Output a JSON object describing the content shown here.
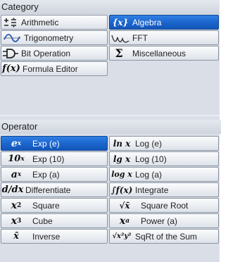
{
  "category": {
    "header": "Category",
    "buttons": [
      {
        "label": "Arithmetic",
        "icon": "plus-minus-icon"
      },
      {
        "label": "Algebra",
        "icon": "curly-x-icon",
        "icon_text": "{x}",
        "selected": true
      },
      {
        "label": "Trigonometry",
        "icon": "sine-wave-icon"
      },
      {
        "label": "FFT",
        "icon": "fft-spectrum-icon"
      },
      {
        "label": "Bit Operation",
        "icon": "logic-gate-icon"
      },
      {
        "label": "Miscellaneous",
        "icon": "sigma-icon",
        "icon_text": "Σ"
      },
      {
        "label": "Formula Editor",
        "icon": "function-icon",
        "icon_text": "f(x)"
      }
    ]
  },
  "operator": {
    "header": "Operator",
    "buttons": [
      {
        "label": "Exp (e)",
        "icon": "e-power-x-icon",
        "selected": true
      },
      {
        "label": "Log (e)",
        "icon": "ln-x-icon"
      },
      {
        "label": "Exp (10)",
        "icon": "ten-power-x-icon"
      },
      {
        "label": "Log (10)",
        "icon": "lg-x-icon"
      },
      {
        "label": "Exp (a)",
        "icon": "a-power-x-icon"
      },
      {
        "label": "Log (a)",
        "icon": "log-x-icon"
      },
      {
        "label": "Differentiate",
        "icon": "d-dx-icon"
      },
      {
        "label": "Integrate",
        "icon": "integral-icon"
      },
      {
        "label": "Square",
        "icon": "x-squared-icon"
      },
      {
        "label": "Square Root",
        "icon": "sqrt-x-icon"
      },
      {
        "label": "Cube",
        "icon": "x-cubed-icon"
      },
      {
        "label": "Power (a)",
        "icon": "x-power-a-icon"
      },
      {
        "label": "Inverse",
        "icon": "x-bar-icon"
      },
      {
        "label": "SqRt of the Sum",
        "icon": "sqrt-sum-squares-icon"
      }
    ]
  },
  "colors": {
    "panel": "#d9dee7",
    "selected": "#1a64cc",
    "border": "#8d96a3"
  }
}
